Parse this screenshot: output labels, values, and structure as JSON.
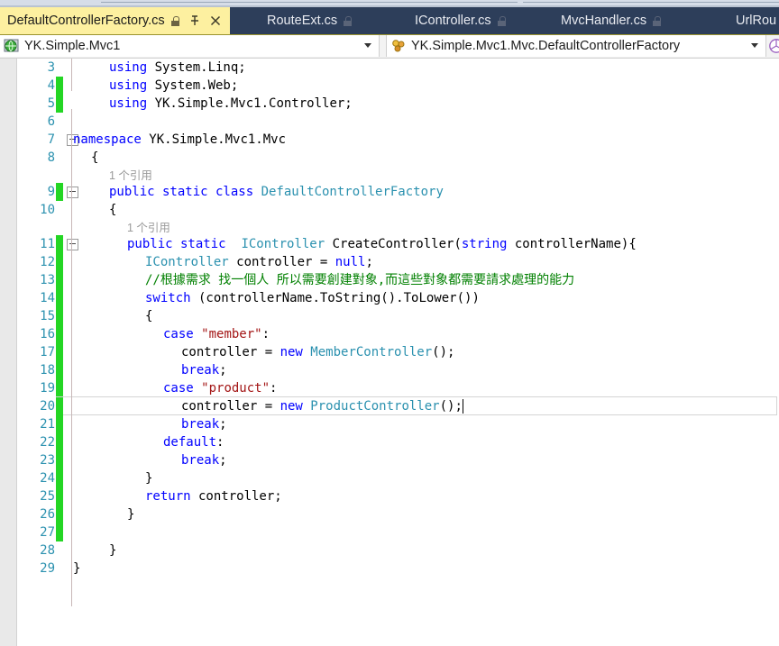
{
  "window": {
    "app": "Visual Studio",
    "accent_tab_active_bg": "#fdf0a0",
    "accent_tabstrip_bg": "#2d3e5a"
  },
  "tabs": [
    {
      "label": "DefaultControllerFactory.cs",
      "active": true,
      "lock_icon": "lock-icon",
      "pin_icon": "pin-icon",
      "close_icon": "close-icon"
    },
    {
      "label": "RouteExt.cs",
      "active": false,
      "lock_icon": "lock-icon"
    },
    {
      "label": "IController.cs",
      "active": false,
      "lock_icon": "lock-icon"
    },
    {
      "label": "MvcHandler.cs",
      "active": false,
      "lock_icon": "lock-icon"
    },
    {
      "label": "UrlRou",
      "active": false,
      "lock_icon": ""
    }
  ],
  "navbar": {
    "project_combo": {
      "value": "YK.Simple.Mvc1",
      "icon": "project-globe-icon",
      "caret": "chevron-down-icon"
    },
    "type_combo": {
      "value": "YK.Simple.Mvc1.Mvc.DefaultControllerFactory",
      "icon": "class-icon",
      "caret": "chevron-down-icon"
    },
    "extra_icon": "cube-icon"
  },
  "editor": {
    "current_line": 20,
    "first_visible_line": 3,
    "last_visible_line": 29,
    "codelens_text": "1 个引用",
    "change_bar_color": "#24d624",
    "lines": [
      {
        "num": 3,
        "indent": 2,
        "partial": true,
        "tokens": [
          {
            "t": "using ",
            "c": "kw"
          },
          {
            "t": "System.Linq;",
            "c": "pl"
          }
        ]
      },
      {
        "num": 4,
        "indent": 2,
        "change": true,
        "tokens": [
          {
            "t": "using ",
            "c": "kw"
          },
          {
            "t": "System.Web;",
            "c": "pl"
          }
        ]
      },
      {
        "num": 5,
        "indent": 2,
        "change": true,
        "tokens": [
          {
            "t": "using ",
            "c": "kw"
          },
          {
            "t": "YK.Simple.Mvc1.Controller;",
            "c": "pl"
          }
        ]
      },
      {
        "num": 6,
        "indent": 0,
        "tokens": []
      },
      {
        "num": 7,
        "indent": 0,
        "outline": true,
        "tokens": [
          {
            "t": "namespace ",
            "c": "kw"
          },
          {
            "t": "YK.Simple.Mvc1.Mvc",
            "c": "pl"
          }
        ]
      },
      {
        "num": 8,
        "indent": 1,
        "tokens": [
          {
            "t": "{",
            "c": "pl"
          }
        ]
      },
      {
        "num": 9,
        "indent": 2,
        "outline": true,
        "change": true,
        "codelens": "1 个引用",
        "tokens": [
          {
            "t": "public static class ",
            "c": "kw"
          },
          {
            "t": "DefaultControllerFactory",
            "c": "typ"
          }
        ]
      },
      {
        "num": 10,
        "indent": 2,
        "tokens": [
          {
            "t": "{",
            "c": "pl"
          }
        ]
      },
      {
        "num": 11,
        "indent": 3,
        "outline": true,
        "change": true,
        "codelens": "1 个引用",
        "tokens": [
          {
            "t": "public static  ",
            "c": "kw"
          },
          {
            "t": "IController",
            "c": "typ"
          },
          {
            "t": " CreateController(",
            "c": "pl"
          },
          {
            "t": "string",
            "c": "kw"
          },
          {
            "t": " controllerName){",
            "c": "pl"
          }
        ]
      },
      {
        "num": 12,
        "indent": 4,
        "change": true,
        "tokens": [
          {
            "t": "IController",
            "c": "typ"
          },
          {
            "t": " controller = ",
            "c": "pl"
          },
          {
            "t": "null",
            "c": "kw"
          },
          {
            "t": ";",
            "c": "pl"
          }
        ]
      },
      {
        "num": 13,
        "indent": 4,
        "change": true,
        "tokens": [
          {
            "t": "//根據需求 找一個人 所以需要創建對象,而這些對象都需要請求處理的能力",
            "c": "cmt"
          }
        ]
      },
      {
        "num": 14,
        "indent": 4,
        "change": true,
        "tokens": [
          {
            "t": "switch",
            "c": "kw"
          },
          {
            "t": " (controllerName.ToString().ToLower())",
            "c": "pl"
          }
        ]
      },
      {
        "num": 15,
        "indent": 4,
        "change": true,
        "tokens": [
          {
            "t": "{",
            "c": "pl"
          }
        ]
      },
      {
        "num": 16,
        "indent": 5,
        "change": true,
        "tokens": [
          {
            "t": "case ",
            "c": "kw"
          },
          {
            "t": "\"member\"",
            "c": "str"
          },
          {
            "t": ":",
            "c": "pl"
          }
        ]
      },
      {
        "num": 17,
        "indent": 6,
        "change": true,
        "tokens": [
          {
            "t": "controller = ",
            "c": "pl"
          },
          {
            "t": "new ",
            "c": "kw"
          },
          {
            "t": "MemberController",
            "c": "typ"
          },
          {
            "t": "();",
            "c": "pl"
          }
        ]
      },
      {
        "num": 18,
        "indent": 6,
        "change": true,
        "tokens": [
          {
            "t": "break",
            "c": "kw"
          },
          {
            "t": ";",
            "c": "pl"
          }
        ]
      },
      {
        "num": 19,
        "indent": 5,
        "change": true,
        "tokens": [
          {
            "t": "case ",
            "c": "kw"
          },
          {
            "t": "\"product\"",
            "c": "str"
          },
          {
            "t": ":",
            "c": "pl"
          }
        ]
      },
      {
        "num": 20,
        "indent": 6,
        "change": true,
        "current": true,
        "tokens": [
          {
            "t": "controller = ",
            "c": "pl"
          },
          {
            "t": "new ",
            "c": "kw"
          },
          {
            "t": "ProductController",
            "c": "typ"
          },
          {
            "t": "();",
            "c": "pl"
          }
        ]
      },
      {
        "num": 21,
        "indent": 6,
        "change": true,
        "tokens": [
          {
            "t": "break",
            "c": "kw"
          },
          {
            "t": ";",
            "c": "pl"
          }
        ]
      },
      {
        "num": 22,
        "indent": 5,
        "change": true,
        "tokens": [
          {
            "t": "default",
            "c": "kw"
          },
          {
            "t": ":",
            "c": "pl"
          }
        ]
      },
      {
        "num": 23,
        "indent": 6,
        "change": true,
        "tokens": [
          {
            "t": "break",
            "c": "kw"
          },
          {
            "t": ";",
            "c": "pl"
          }
        ]
      },
      {
        "num": 24,
        "indent": 4,
        "change": true,
        "tokens": [
          {
            "t": "}",
            "c": "pl"
          }
        ]
      },
      {
        "num": 25,
        "indent": 4,
        "change": true,
        "tokens": [
          {
            "t": "return",
            "c": "kw"
          },
          {
            "t": " controller;",
            "c": "pl"
          }
        ]
      },
      {
        "num": 26,
        "indent": 3,
        "change": true,
        "tokens": [
          {
            "t": "}",
            "c": "pl"
          }
        ]
      },
      {
        "num": 27,
        "indent": 0,
        "change": true,
        "tokens": []
      },
      {
        "num": 28,
        "indent": 2,
        "tokens": [
          {
            "t": "}",
            "c": "pl"
          }
        ]
      },
      {
        "num": 29,
        "indent": 0,
        "tokens": [
          {
            "t": "}",
            "c": "pl"
          }
        ]
      }
    ]
  }
}
